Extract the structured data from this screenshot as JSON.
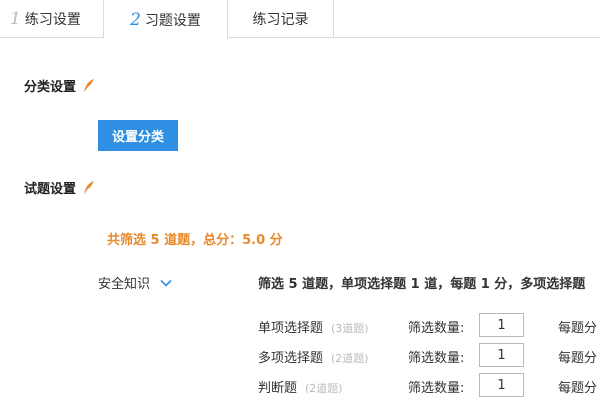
{
  "tabs": [
    {
      "num": "1",
      "label": "练习设置"
    },
    {
      "num": "2",
      "label": "习题设置"
    },
    {
      "num": "",
      "label": "练习记录"
    }
  ],
  "category_section": {
    "title": "分类设置",
    "icon": "feather-icon",
    "button_label": "设置分类"
  },
  "question_section": {
    "title": "试题设置",
    "icon": "feather-icon"
  },
  "summary": "共筛选 5 道题，总分：5.0 分",
  "knowledge": {
    "label": "安全知识",
    "icon": "chevron-down-icon"
  },
  "filter_text": "筛选 5 道题，单项选择题 1 道，每题 1 分，多项选择题",
  "rows": [
    {
      "type": "单项选择题",
      "count": "(3道题)",
      "filter_label": "筛选数量:",
      "qty": "1",
      "per_label": "每题分"
    },
    {
      "type": "多项选择题",
      "count": "(2道题)",
      "filter_label": "筛选数量:",
      "qty": "1",
      "per_label": "每题分"
    },
    {
      "type": "判断题",
      "count": "(2道题)",
      "filter_label": "筛选数量:",
      "qty": "1",
      "per_label": "每题分"
    }
  ],
  "colors": {
    "accent": "#2f90e3",
    "summary": "#e8892a",
    "feather": "#e8892a"
  }
}
